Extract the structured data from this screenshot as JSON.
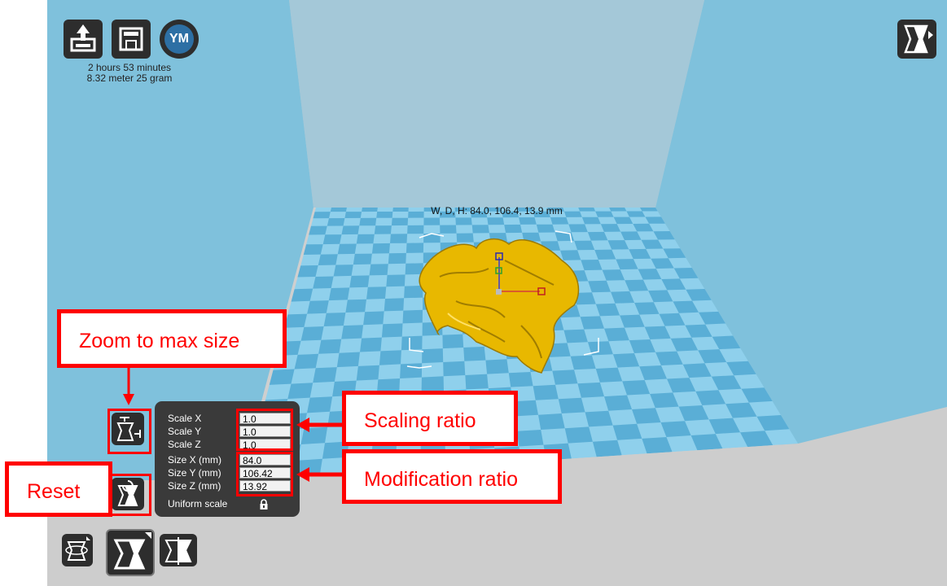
{
  "top_toolbar": {
    "load_button": "load-model",
    "save_button": "save-model",
    "avatar_text": "YM",
    "print_time": "2 hours 53 minutes",
    "print_material": "8.32 meter 25 gram"
  },
  "viewport": {
    "dimensions_label": "W, D, H: 84.0, 106.4, 13.9 mm",
    "colors": {
      "walls": "#7fc1dc",
      "back_wall": "#a4c8d8",
      "floor_tile_dark": "#5aaed6",
      "floor_tile_light": "#8fd0ec",
      "model": "#e8b800"
    }
  },
  "scale_panel": {
    "scale_x_label": "Scale X",
    "scale_y_label": "Scale Y",
    "scale_z_label": "Scale Z",
    "size_x_label": "Size X (mm)",
    "size_y_label": "Size Y (mm)",
    "size_z_label": "Size Z (mm)",
    "uniform_label": "Uniform scale",
    "scale_x": "1.0",
    "scale_y": "1.0",
    "scale_z": "1.0",
    "size_x": "84.0",
    "size_y": "106.42",
    "size_z": "13.92"
  },
  "annotations": {
    "zoom": "Zoom to max size",
    "scaling": "Scaling ratio",
    "modification": "Modification ratio",
    "reset": "Reset",
    "color": "#ff0000"
  },
  "icons": [
    "load-icon",
    "save-icon",
    "view-mode-icon",
    "max-size-icon",
    "reset-icon",
    "rotate-tool-icon",
    "scale-tool-icon",
    "mirror-tool-icon",
    "lock-icon"
  ]
}
